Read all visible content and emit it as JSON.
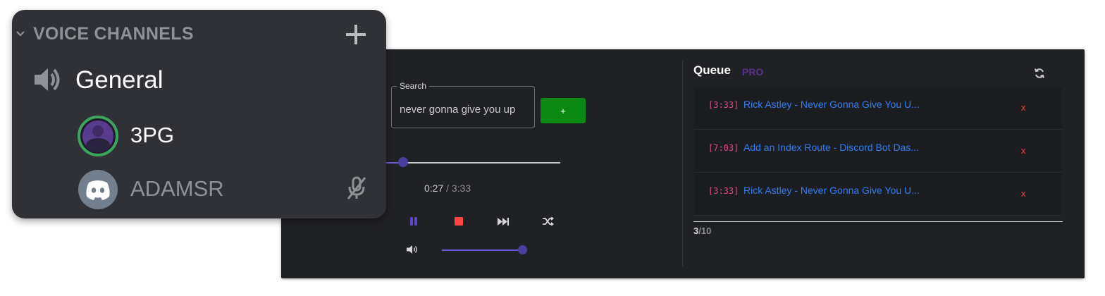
{
  "dashboard": {
    "search": {
      "legend": "Search",
      "value": "never gonna give you up"
    },
    "add_button_label": "+",
    "player": {
      "current_time": "0:27",
      "separator": "/",
      "total_time": "3:33",
      "progress_fraction": 0.127,
      "volume_fraction": 1.0,
      "controls": [
        "pause-icon",
        "stop-icon",
        "fast-forward-icon",
        "shuffle-icon",
        "volume-icon"
      ],
      "colors": {
        "accent": "#6e5bd6",
        "knob": "#4b3f9e",
        "stop": "#ff4444"
      }
    },
    "queue": {
      "title": "Queue",
      "badge": "PRO",
      "refresh_icon": "refresh-icon",
      "items": [
        {
          "duration": "[3:33]",
          "title": "Rick Astley - Never Gonna Give You U...",
          "remove": "x"
        },
        {
          "duration": "[7:03]",
          "title": "Add an Index Route - Discord Bot Das...",
          "remove": "x"
        },
        {
          "duration": "[3:33]",
          "title": "Rick Astley - Never Gonna Give You U...",
          "remove": "x"
        }
      ],
      "count_current": "3",
      "count_sep": "/",
      "count_max": "10"
    }
  },
  "voice": {
    "header": "VOICE CHANNELS",
    "add_icon": "plus-icon",
    "channel_icon": "speaker-icon",
    "channel_name": "General",
    "users": [
      {
        "name": "3PG",
        "avatar": "bot-avatar",
        "active": true
      },
      {
        "name": "ADAMSR",
        "avatar": "discord-avatar",
        "active": false,
        "muted_icon": "mic-muted-icon"
      }
    ],
    "colors": {
      "speaking_ring": "#3ba55c",
      "bg": "#2f3136"
    }
  }
}
